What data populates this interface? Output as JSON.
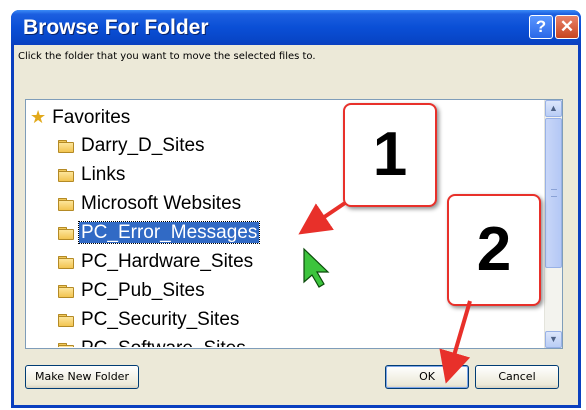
{
  "window": {
    "title": "Browse For Folder",
    "help_label": "?",
    "close_label": "✕"
  },
  "instruction": "Click the folder that you want to move the selected files to.",
  "tree": {
    "items": [
      {
        "label": "Favorites",
        "icon": "star-icon"
      },
      {
        "label": "Darry_D_Sites",
        "icon": "folder-icon"
      },
      {
        "label": "Links",
        "icon": "folder-icon"
      },
      {
        "label": "Microsoft Websites",
        "icon": "folder-icon"
      },
      {
        "label": "PC_Error_Messages",
        "icon": "folder-icon",
        "selected": true
      },
      {
        "label": "PC_Hardware_Sites",
        "icon": "folder-icon"
      },
      {
        "label": "PC_Pub_Sites",
        "icon": "folder-icon"
      },
      {
        "label": "PC_Security_Sites",
        "icon": "folder-icon"
      },
      {
        "label": "PC_Software_Sites",
        "icon": "folder-icon"
      }
    ]
  },
  "buttons": {
    "make_new_folder": "Make New Folder",
    "ok": "OK",
    "cancel": "Cancel"
  },
  "callouts": {
    "step1": "1",
    "step2": "2"
  },
  "colors": {
    "title_bar": "#0a4fd6",
    "selection": "#316ac5",
    "callout_border": "#e8302a",
    "pointer": "#3cc43c"
  }
}
